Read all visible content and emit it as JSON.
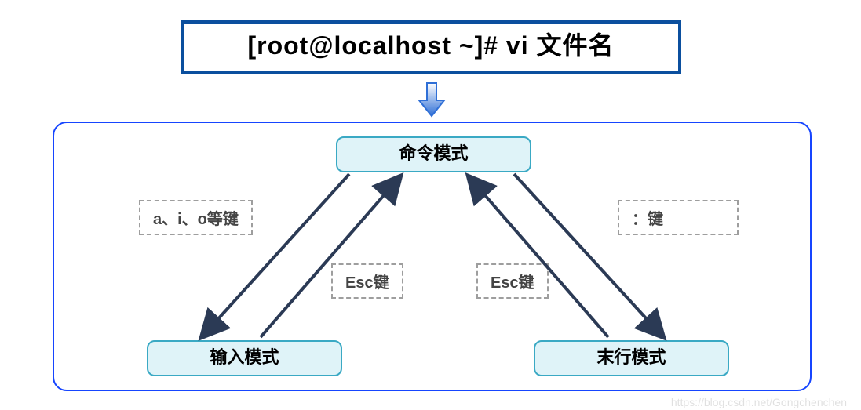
{
  "title": "[root@localhost ~]# vi 文件名",
  "modes": {
    "command": "命令模式",
    "insert": "输入模式",
    "lastline": "末行模式"
  },
  "keys": {
    "enter_insert": "a、i、o等键",
    "enter_lastline": "：键",
    "esc_left": "Esc键",
    "esc_right": "Esc键"
  },
  "watermark": "https://blog.csdn.net/Gongchenchen"
}
